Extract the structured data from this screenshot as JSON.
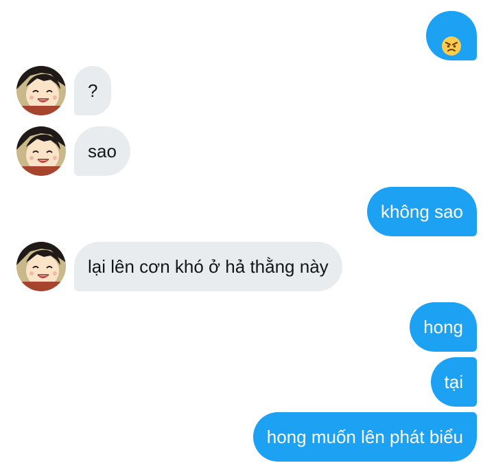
{
  "conversation": {
    "messages": [
      {
        "direction": "out",
        "icon": "angry-face-emoji",
        "text": ""
      },
      {
        "direction": "in",
        "text": "?"
      },
      {
        "direction": "in",
        "text": "sao"
      },
      {
        "direction": "out",
        "text": "không sao"
      },
      {
        "direction": "in",
        "text": "lại lên cơn khó ở hả thằng này"
      },
      {
        "direction": "out",
        "text": "hong"
      },
      {
        "direction": "out",
        "text": "tại"
      },
      {
        "direction": "out",
        "text": "hong muốn lên phát biểu"
      }
    ]
  },
  "colors": {
    "outgoing_bubble": "#1da1f2",
    "incoming_bubble": "#e8ecef",
    "outgoing_text": "#ffffff",
    "incoming_text": "#14171a"
  },
  "contact": {
    "avatar_icon": "cartoon-boy-avatar-icon"
  }
}
